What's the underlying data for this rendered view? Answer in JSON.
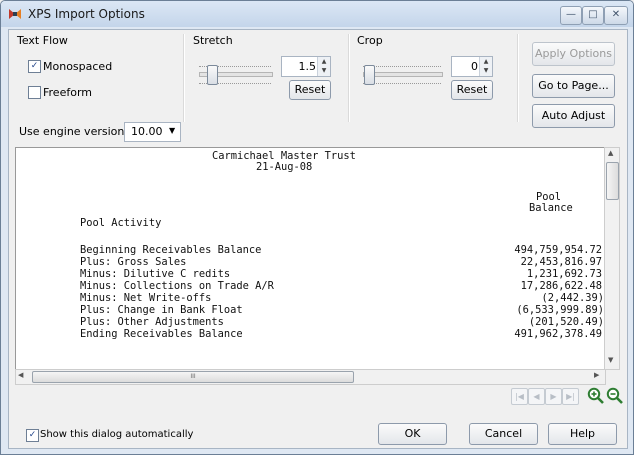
{
  "window": {
    "title": "XPS Import Options"
  },
  "controls": {
    "text_flow_label": "Text Flow",
    "monospaced_label": "Monospaced",
    "monospaced_checked": true,
    "freeform_label": "Freeform",
    "freeform_checked": false,
    "stretch_label": "Stretch",
    "stretch_value": "1.5",
    "crop_label": "Crop",
    "crop_value": "0",
    "reset_label": "Reset",
    "engine_label": "Use engine version:",
    "engine_value": "10.00",
    "apply_label": "Apply Options",
    "goto_label": "Go to Page...",
    "auto_adjust_label": "Auto Adjust"
  },
  "document": {
    "title": "Carmichael Master Trust",
    "date": "21-Aug-08",
    "col_header_1": "Pool",
    "col_header_2": "Balance",
    "section": "Pool Activity",
    "rows": [
      {
        "label": "Beginning Receivables Balance",
        "value": "494,759,954.72"
      },
      {
        "label": "Plus: Gross Sales",
        "value": "22,453,816.97"
      },
      {
        "label": "Minus: Dilutive C redits",
        "value": "1,231,692.73"
      },
      {
        "label": "Minus: Collections on Trade A/R",
        "value": "17,286,622.48"
      },
      {
        "label": "Minus: Net Write-offs",
        "value": "(2,442.39)"
      },
      {
        "label": "Plus: Change in Bank Float",
        "value": "(6,533,999.89)"
      },
      {
        "label": "Plus: Other Adjustments",
        "value": "(201,520.49)"
      },
      {
        "label": "Ending Receivables Balance",
        "value": "491,962,378.49"
      }
    ]
  },
  "scrollbar": {
    "h_thumb_glyph": "III"
  },
  "footer": {
    "show_dialog_label": "Show this dialog automatically",
    "show_dialog_checked": true,
    "ok_label": "OK",
    "cancel_label": "Cancel",
    "help_label": "Help"
  },
  "colors": {
    "titlebar": "#c4d5ea",
    "zoom_icon": "#2e7d32"
  }
}
